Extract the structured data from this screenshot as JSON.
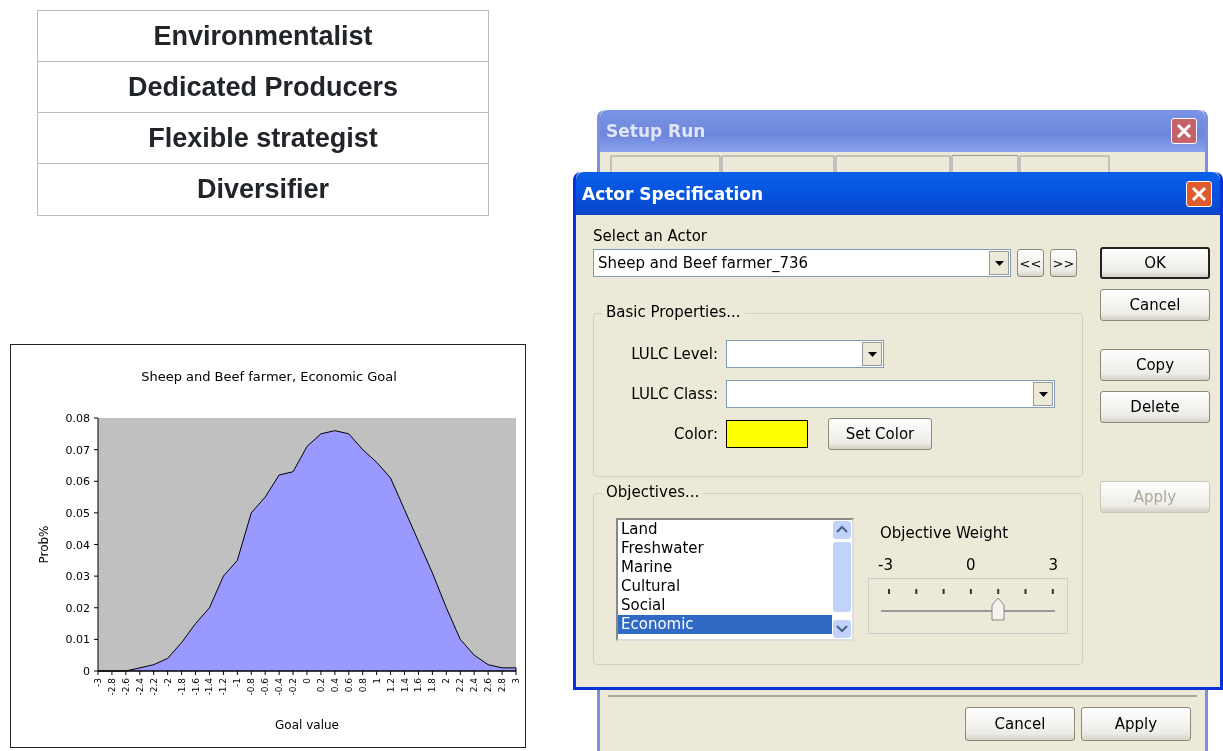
{
  "table": {
    "rows": [
      "Environmentalist",
      "Dedicated Producers",
      "Flexible strategist",
      "Diversifier"
    ]
  },
  "chart": {
    "chart_data": {
      "type": "area",
      "title": "Sheep and Beef farmer, Economic Goal",
      "xlabel": "Goal value",
      "ylabel": "Prob%",
      "categories": [
        "-3",
        "-2.8",
        "-2.6",
        "-2.4",
        "-2.2",
        "-2",
        "-1.8",
        "-1.6",
        "-1.4",
        "-1.2",
        "-1",
        "-0.8",
        "-0.6",
        "-0.4",
        "-0.2",
        "0",
        "0.2",
        "0.4",
        "0.6",
        "0.8",
        "1",
        "1.2",
        "1.4",
        "1.6",
        "1.8",
        "2",
        "2.2",
        "2.4",
        "2.6",
        "2.8",
        "3"
      ],
      "series": [
        {
          "color": "#9999ff",
          "values": [
            0,
            0,
            0,
            0.001,
            0.002,
            0.004,
            0.009,
            0.015,
            0.02,
            0.03,
            0.035,
            0.05,
            0.055,
            0.062,
            0.063,
            0.071,
            0.075,
            0.076,
            0.075,
            0.07,
            0.066,
            0.061,
            0.051,
            0.041,
            0.031,
            0.02,
            0.01,
            0.005,
            0.002,
            0.001,
            0.001
          ]
        }
      ],
      "ylim": [
        0,
        0.08
      ],
      "yticks": [
        0,
        0.01,
        0.02,
        0.03,
        0.04,
        0.05,
        0.06,
        0.07,
        0.08
      ]
    }
  },
  "setup_run": {
    "title": "Setup Run",
    "buttons": [
      "Cancel",
      "Apply"
    ]
  },
  "actor_dialog": {
    "title": "Actor Specification",
    "select_label": "Select an Actor",
    "actor_select": {
      "value": "Sheep and Beef farmer_736"
    },
    "nav_buttons": [
      "<<",
      ">>"
    ],
    "basic_properties": {
      "legend": "Basic Properties...",
      "lulc_level_label": "LULC Level:",
      "lulc_class_label": "LULC Class:",
      "color_label": "Color:",
      "color": "#ffff00",
      "set_color_button": "Set Color"
    },
    "objectives": {
      "legend": "Objectives...",
      "items": [
        {
          "label": "Land",
          "selected": false
        },
        {
          "label": "Freshwater",
          "selected": false
        },
        {
          "label": "Marine",
          "selected": false
        },
        {
          "label": "Cultural",
          "selected": false
        },
        {
          "label": "Social",
          "selected": false
        },
        {
          "label": "Economic",
          "selected": true
        }
      ],
      "weight_label": "Objective Weight",
      "scale_labels": [
        "-3",
        "0",
        "3"
      ],
      "slider": {
        "level": 0.667
      }
    },
    "button_groups": [
      [
        {
          "label": "OK",
          "default": true,
          "disabled": false
        },
        {
          "label": "Cancel",
          "default": false,
          "disabled": false
        }
      ],
      [
        {
          "label": "Copy",
          "default": false,
          "disabled": false
        },
        {
          "label": "Delete",
          "default": false,
          "disabled": false
        }
      ],
      [
        {
          "label": "Apply",
          "default": false,
          "disabled": true
        }
      ]
    ]
  }
}
